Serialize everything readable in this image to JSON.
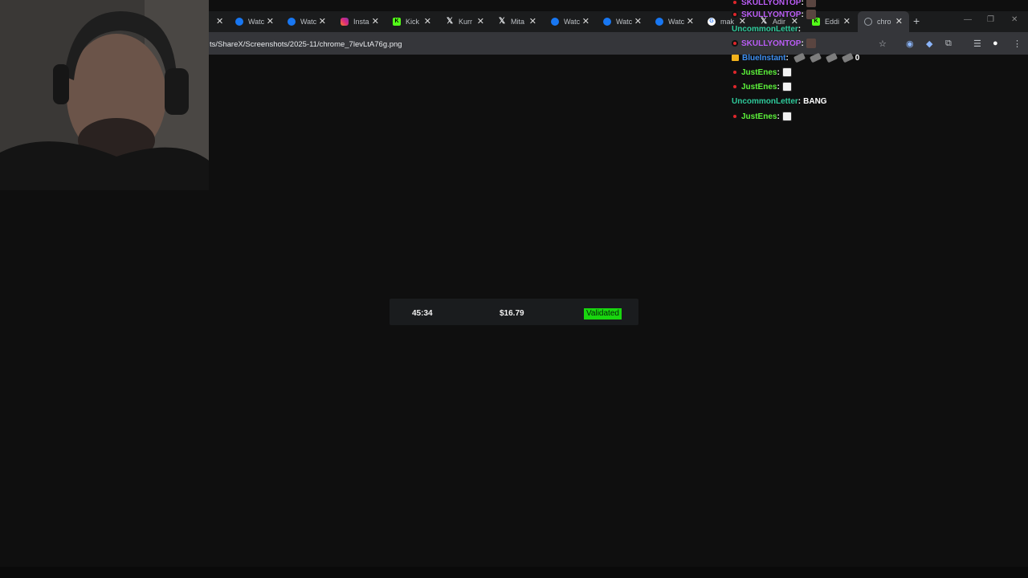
{
  "browser": {
    "tabs": [
      {
        "label": "Watc",
        "icon": "meta-icon",
        "cls": "ic-meta"
      },
      {
        "label": "Watc",
        "icon": "meta-icon",
        "cls": "ic-meta"
      },
      {
        "label": "Insta",
        "icon": "instagram-icon",
        "cls": "ic-insta"
      },
      {
        "label": "Kick",
        "icon": "kick-icon",
        "cls": "ic-kick"
      },
      {
        "label": "Kurr",
        "icon": "x-logo-icon",
        "cls": "ic-x"
      },
      {
        "label": "Mita",
        "icon": "x-logo-icon",
        "cls": "ic-x"
      },
      {
        "label": "Watc",
        "icon": "meta-icon",
        "cls": "ic-meta"
      },
      {
        "label": "Watc",
        "icon": "meta-icon",
        "cls": "ic-meta"
      },
      {
        "label": "Watc",
        "icon": "meta-icon",
        "cls": "ic-meta"
      },
      {
        "label": "mak",
        "icon": "google-icon",
        "cls": "ic-g"
      },
      {
        "label": "Adir",
        "icon": "x-logo-icon",
        "cls": "ic-x"
      },
      {
        "label": "Eddi",
        "icon": "kick-icon",
        "cls": "ic-kick"
      },
      {
        "label": "chro",
        "icon": "globe-icon",
        "cls": "ic-globe",
        "active": true
      }
    ],
    "new_tab": "+",
    "url": "ts/ShareX/Screenshots/2025-11/chrome_7levLtA76g.png"
  },
  "overlay": {
    "time": "45:34",
    "price": "$16.79",
    "status": "Validated"
  },
  "chat": [
    {
      "user": "SKULLYONTOP",
      "color": "#b95cf4",
      "badge": "dot",
      "sep": " :",
      "emotes": [
        "skull"
      ],
      "text": ""
    },
    {
      "user": "SKULLYONTOP",
      "color": "#b95cf4",
      "badge": "dot",
      "sep": " :",
      "emotes": [
        "skull"
      ],
      "text": ""
    },
    {
      "user": "UncommonLetter",
      "color": "#2ec99a",
      "badge": "",
      "sep": " :",
      "emotes": [],
      "text": ""
    },
    {
      "user": "SKULLYONTOP",
      "color": "#b95cf4",
      "badge": "dot",
      "sep": " :",
      "emotes": [
        "skull"
      ],
      "text": ""
    },
    {
      "user": "BlueInstant",
      "color": "#3d8ef0",
      "badge": "crown",
      "sep": " :",
      "emotes": [
        "gun",
        "gun",
        "gun",
        "gun"
      ],
      "text": "0"
    },
    {
      "user": "JustEnes",
      "color": "#5cf23a",
      "badge": "dot",
      "sep": " :",
      "emotes": [
        "face"
      ],
      "text": ""
    },
    {
      "user": "JustEnes",
      "color": "#5cf23a",
      "badge": "dot",
      "sep": " :",
      "emotes": [
        "face"
      ],
      "text": ""
    },
    {
      "user": "UncommonLetter",
      "color": "#2ec99a",
      "badge": "",
      "sep": " :",
      "emotes": [],
      "text": "BANG"
    },
    {
      "user": "JustEnes",
      "color": "#5cf23a",
      "badge": "dot",
      "sep": " :",
      "emotes": [
        "face"
      ],
      "text": ""
    }
  ]
}
